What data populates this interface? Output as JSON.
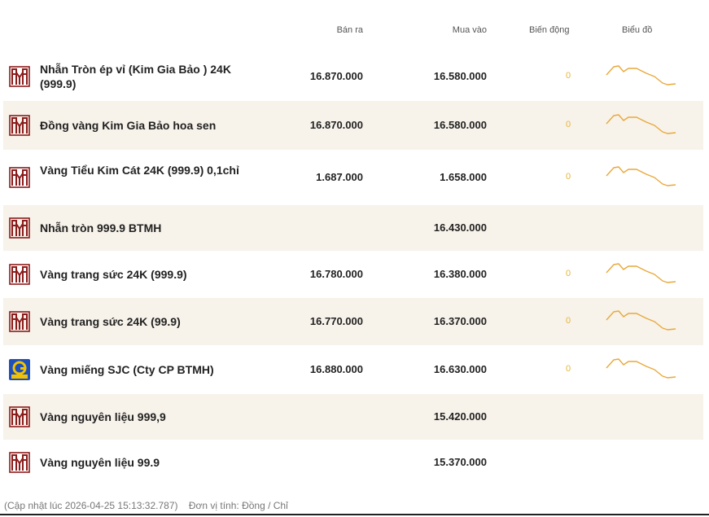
{
  "header": {
    "ban_ra": "Bán ra",
    "mua_vao": "Mua vào",
    "bien_dong": "Biến động",
    "bieu_do": "Biểu đồ"
  },
  "rows": [
    {
      "name": "Nhẫn Tròn ép vỉ (Kim Gia Bảo ) 24K (999.9)",
      "ban_ra": "16.870.000",
      "mua_vao": "16.580.000",
      "bien_dong": "0",
      "logo": "btmh-logo-icon",
      "has_chart": true
    },
    {
      "name": "Đồng vàng Kim Gia Bảo hoa sen",
      "ban_ra": "16.870.000",
      "mua_vao": "16.580.000",
      "bien_dong": "0",
      "logo": "btmh-logo-icon",
      "has_chart": true
    },
    {
      "name": "Vàng Tiểu Kim Cát 24K (999.9) 0,1chỉ",
      "ban_ra": "1.687.000",
      "mua_vao": "1.658.000",
      "bien_dong": "0",
      "logo": "btmh-logo-icon",
      "has_chart": true
    },
    {
      "name": "Nhẫn tròn 999.9 BTMH",
      "ban_ra": "",
      "mua_vao": "16.430.000",
      "bien_dong": "",
      "logo": "btmh-logo-icon",
      "has_chart": false
    },
    {
      "name": "Vàng trang sức 24K (999.9)",
      "ban_ra": "16.780.000",
      "mua_vao": "16.380.000",
      "bien_dong": "0",
      "logo": "btmh-logo-icon",
      "has_chart": true
    },
    {
      "name": "Vàng trang sức 24K (99.9)",
      "ban_ra": "16.770.000",
      "mua_vao": "16.370.000",
      "bien_dong": "0",
      "logo": "btmh-logo-icon",
      "has_chart": true
    },
    {
      "name": "Vàng miếng SJC (Cty CP BTMH)",
      "ban_ra": "16.880.000",
      "mua_vao": "16.630.000",
      "bien_dong": "0",
      "logo": "sjc-logo-icon",
      "has_chart": true
    },
    {
      "name": "Vàng nguyên liệu 999,9",
      "ban_ra": "",
      "mua_vao": "15.420.000",
      "bien_dong": "",
      "logo": "btmh-logo-icon",
      "has_chart": false
    },
    {
      "name": "Vàng nguyên liệu 99.9",
      "ban_ra": "",
      "mua_vao": "15.370.000",
      "bien_dong": "",
      "logo": "btmh-logo-icon",
      "has_chart": false
    }
  ],
  "footer": {
    "updated": "(Cập nhật lúc 2026-04-25 15:13:32.787)",
    "unit": "Đơn vị tính: Đồng / Chỉ"
  },
  "colors": {
    "alt_row_bg": "#f7f2ea",
    "logo_red": "#8b1c1c",
    "spark_line": "#e8a93a",
    "change_zero": "#e8b53a"
  }
}
